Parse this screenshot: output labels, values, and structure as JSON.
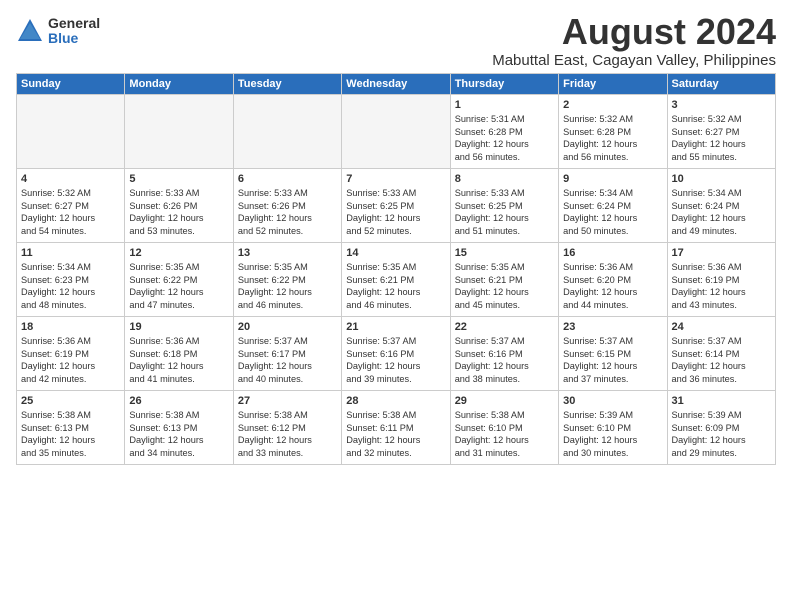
{
  "logo": {
    "general": "General",
    "blue": "Blue"
  },
  "title": "August 2024",
  "location": "Mabuttal East, Cagayan Valley, Philippines",
  "headers": [
    "Sunday",
    "Monday",
    "Tuesday",
    "Wednesday",
    "Thursday",
    "Friday",
    "Saturday"
  ],
  "weeks": [
    [
      {
        "day": "",
        "info": "",
        "empty": true
      },
      {
        "day": "",
        "info": "",
        "empty": true
      },
      {
        "day": "",
        "info": "",
        "empty": true
      },
      {
        "day": "",
        "info": "",
        "empty": true
      },
      {
        "day": "1",
        "info": "Sunrise: 5:31 AM\nSunset: 6:28 PM\nDaylight: 12 hours\nand 56 minutes."
      },
      {
        "day": "2",
        "info": "Sunrise: 5:32 AM\nSunset: 6:28 PM\nDaylight: 12 hours\nand 56 minutes."
      },
      {
        "day": "3",
        "info": "Sunrise: 5:32 AM\nSunset: 6:27 PM\nDaylight: 12 hours\nand 55 minutes."
      }
    ],
    [
      {
        "day": "4",
        "info": "Sunrise: 5:32 AM\nSunset: 6:27 PM\nDaylight: 12 hours\nand 54 minutes."
      },
      {
        "day": "5",
        "info": "Sunrise: 5:33 AM\nSunset: 6:26 PM\nDaylight: 12 hours\nand 53 minutes."
      },
      {
        "day": "6",
        "info": "Sunrise: 5:33 AM\nSunset: 6:26 PM\nDaylight: 12 hours\nand 52 minutes."
      },
      {
        "day": "7",
        "info": "Sunrise: 5:33 AM\nSunset: 6:25 PM\nDaylight: 12 hours\nand 52 minutes."
      },
      {
        "day": "8",
        "info": "Sunrise: 5:33 AM\nSunset: 6:25 PM\nDaylight: 12 hours\nand 51 minutes."
      },
      {
        "day": "9",
        "info": "Sunrise: 5:34 AM\nSunset: 6:24 PM\nDaylight: 12 hours\nand 50 minutes."
      },
      {
        "day": "10",
        "info": "Sunrise: 5:34 AM\nSunset: 6:24 PM\nDaylight: 12 hours\nand 49 minutes."
      }
    ],
    [
      {
        "day": "11",
        "info": "Sunrise: 5:34 AM\nSunset: 6:23 PM\nDaylight: 12 hours\nand 48 minutes."
      },
      {
        "day": "12",
        "info": "Sunrise: 5:35 AM\nSunset: 6:22 PM\nDaylight: 12 hours\nand 47 minutes."
      },
      {
        "day": "13",
        "info": "Sunrise: 5:35 AM\nSunset: 6:22 PM\nDaylight: 12 hours\nand 46 minutes."
      },
      {
        "day": "14",
        "info": "Sunrise: 5:35 AM\nSunset: 6:21 PM\nDaylight: 12 hours\nand 46 minutes."
      },
      {
        "day": "15",
        "info": "Sunrise: 5:35 AM\nSunset: 6:21 PM\nDaylight: 12 hours\nand 45 minutes."
      },
      {
        "day": "16",
        "info": "Sunrise: 5:36 AM\nSunset: 6:20 PM\nDaylight: 12 hours\nand 44 minutes."
      },
      {
        "day": "17",
        "info": "Sunrise: 5:36 AM\nSunset: 6:19 PM\nDaylight: 12 hours\nand 43 minutes."
      }
    ],
    [
      {
        "day": "18",
        "info": "Sunrise: 5:36 AM\nSunset: 6:19 PM\nDaylight: 12 hours\nand 42 minutes."
      },
      {
        "day": "19",
        "info": "Sunrise: 5:36 AM\nSunset: 6:18 PM\nDaylight: 12 hours\nand 41 minutes."
      },
      {
        "day": "20",
        "info": "Sunrise: 5:37 AM\nSunset: 6:17 PM\nDaylight: 12 hours\nand 40 minutes."
      },
      {
        "day": "21",
        "info": "Sunrise: 5:37 AM\nSunset: 6:16 PM\nDaylight: 12 hours\nand 39 minutes."
      },
      {
        "day": "22",
        "info": "Sunrise: 5:37 AM\nSunset: 6:16 PM\nDaylight: 12 hours\nand 38 minutes."
      },
      {
        "day": "23",
        "info": "Sunrise: 5:37 AM\nSunset: 6:15 PM\nDaylight: 12 hours\nand 37 minutes."
      },
      {
        "day": "24",
        "info": "Sunrise: 5:37 AM\nSunset: 6:14 PM\nDaylight: 12 hours\nand 36 minutes."
      }
    ],
    [
      {
        "day": "25",
        "info": "Sunrise: 5:38 AM\nSunset: 6:13 PM\nDaylight: 12 hours\nand 35 minutes."
      },
      {
        "day": "26",
        "info": "Sunrise: 5:38 AM\nSunset: 6:13 PM\nDaylight: 12 hours\nand 34 minutes."
      },
      {
        "day": "27",
        "info": "Sunrise: 5:38 AM\nSunset: 6:12 PM\nDaylight: 12 hours\nand 33 minutes."
      },
      {
        "day": "28",
        "info": "Sunrise: 5:38 AM\nSunset: 6:11 PM\nDaylight: 12 hours\nand 32 minutes."
      },
      {
        "day": "29",
        "info": "Sunrise: 5:38 AM\nSunset: 6:10 PM\nDaylight: 12 hours\nand 31 minutes."
      },
      {
        "day": "30",
        "info": "Sunrise: 5:39 AM\nSunset: 6:10 PM\nDaylight: 12 hours\nand 30 minutes."
      },
      {
        "day": "31",
        "info": "Sunrise: 5:39 AM\nSunset: 6:09 PM\nDaylight: 12 hours\nand 29 minutes."
      }
    ]
  ]
}
